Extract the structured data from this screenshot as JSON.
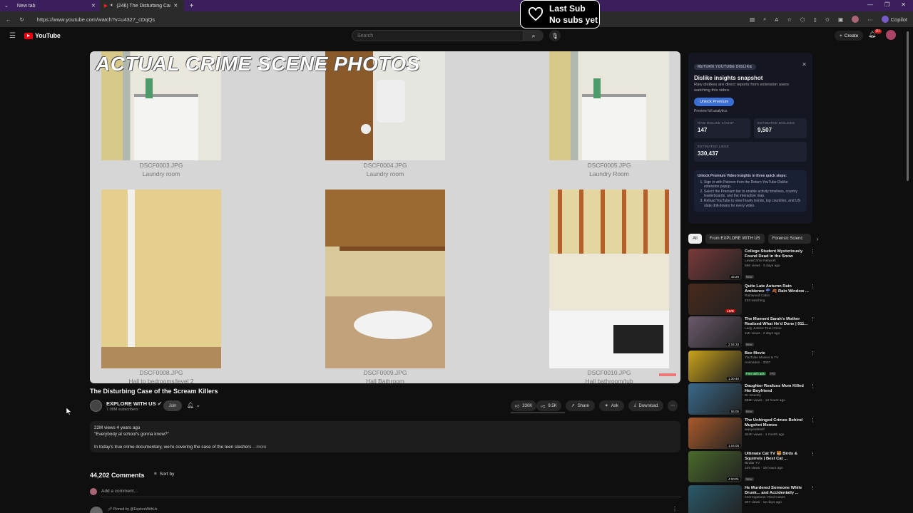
{
  "browser": {
    "tabs": [
      {
        "label": "New tab",
        "active": false
      },
      {
        "label": "(246) The Disturbing Case of",
        "active": true
      }
    ],
    "url": "https://www.youtube.com/watch?v=u4327_cDqQs",
    "copilot_label": "Copilot"
  },
  "sub_badge": {
    "line1": "Last Sub",
    "line2": "No subs yet"
  },
  "header": {
    "logo": "YouTube",
    "search_placeholder": "Search",
    "create_label": "Create",
    "notif_count": "9+"
  },
  "video": {
    "overlay_title": "ACTUAL CRIME SCENE PHOTOS",
    "photos": [
      {
        "file": "DSCF0003.JPG",
        "label": "Laundry room"
      },
      {
        "file": "DSCF0004.JPG",
        "label": "Laundry room"
      },
      {
        "file": "DSCF0005.JPG",
        "label": "Laundry Room"
      },
      {
        "file": "DSCF0008.JPG",
        "label": "Hall to bedrooms/level 2"
      },
      {
        "file": "DSCF0009.JPG",
        "label": "Hall Bathroom"
      },
      {
        "file": "DSCF0010.JPG",
        "label": "Hall bathroom/tub"
      }
    ],
    "title": "The Disturbing Case of the Scream Killers",
    "channel": "EXPLORE WITH US",
    "subscribers": "7.08M subscribers",
    "join_label": "Join",
    "likes": "330K",
    "dislikes": "9.5K",
    "share_label": "Share",
    "ask_label": "Ask",
    "download_label": "Download"
  },
  "description": {
    "meta": "22M views  4 years ago",
    "quote": "\"Everybody at school's gonna know?\"",
    "text": "In today's true crime documentary, we're covering the case of the teen slashers",
    "more": "...more"
  },
  "comments": {
    "count": "44,202 Comments",
    "sort_label": "Sort by",
    "add_placeholder": "Add a comment...",
    "pinned": "Pinned by @ExploreWithUs"
  },
  "dislike_panel": {
    "tag": "RETURN YOUTUBE DISLIKE",
    "title": "Dislike insights snapshot",
    "desc": "Raw dislikes are direct reports from extension users watching this video.",
    "button": "Unlock Premium",
    "preview": "Preview full analytics",
    "raw_label": "RAW DISLIKE COUNT",
    "raw_value": "147",
    "est_dislikes_label": "ESTIMATED DISLIKES",
    "est_dislikes_value": "9,507",
    "est_likes_label": "ESTIMATED LIKES",
    "est_likes_value": "330,437",
    "steps_title": "Unlock Premium Video Insights in three quick steps:",
    "steps": [
      "Sign in with Patreon from the Return YouTube Dislike extension popup.",
      "Select the Premium tier to enable activity timelines, country leaderboards, and the interactive map.",
      "Reload YouTube to view hourly trends, top countries, and US state drill-downs for every video."
    ]
  },
  "chips": [
    "All",
    "From EXPLORE WITH US",
    "Forensic Scienc"
  ],
  "recommendations": [
    {
      "title": "College Student Mysteriously Found Dead in the Snow",
      "channel": "Law&Crime Network",
      "meta": "56K views · 5 days ago",
      "badge": "New",
      "duration": "42:29",
      "color": "#7a3a3a"
    },
    {
      "title": "Quite Late Autumn Rain Ambience ☔ 🍂 Rain Window ...",
      "channel": "Rainwood Cabin",
      "meta": "133 watching",
      "badge": "",
      "duration": "",
      "live": "LIVE",
      "color": "#4a2a1c"
    },
    {
      "title": "The Moment Sarah's Mother Realized What He'd Done | 911...",
      "channel": "Lady Justice True Crime",
      "meta": "11K views · 2 days ago",
      "badge": "New",
      "duration": "2:04:33",
      "color": "#6a5a6a"
    },
    {
      "title": "Bee Movie",
      "channel": "YouTube Movies & TV",
      "meta": "Animation · 2007",
      "badge": "Free with ads",
      "badge2": "PG",
      "duration": "1:30:40",
      "color": "#c9a21a"
    },
    {
      "title": "Daughter Realizes Mom Killed Her Boyfriend",
      "channel": "Dr Insanity",
      "meta": "659K views · 12 hours ago",
      "badge": "New",
      "duration": "55:05",
      "color": "#3a6a8a"
    },
    {
      "title": "The Unhinged Crimes Behind Mugshot Memes",
      "channel": "wanyeatitself",
      "meta": "344K views · 1 month ago",
      "badge": "",
      "duration": "1:04:00",
      "color": "#a85a2a"
    },
    {
      "title": "Ultimate Cat TV 🐯 Birds & Squirrels | Best Cat ...",
      "channel": "Bindar TV",
      "meta": "236 views · 19 hours ago",
      "badge": "New",
      "duration": "4:00:01",
      "color": "#4a6a2a"
    },
    {
      "title": "He Murdered Someone While Drunk... and Accidentally ...",
      "channel": "Interrogations: Real Cases",
      "meta": "207 views · 12 days ago",
      "badge": "",
      "duration": "",
      "color": "#2a5a6a"
    }
  ]
}
